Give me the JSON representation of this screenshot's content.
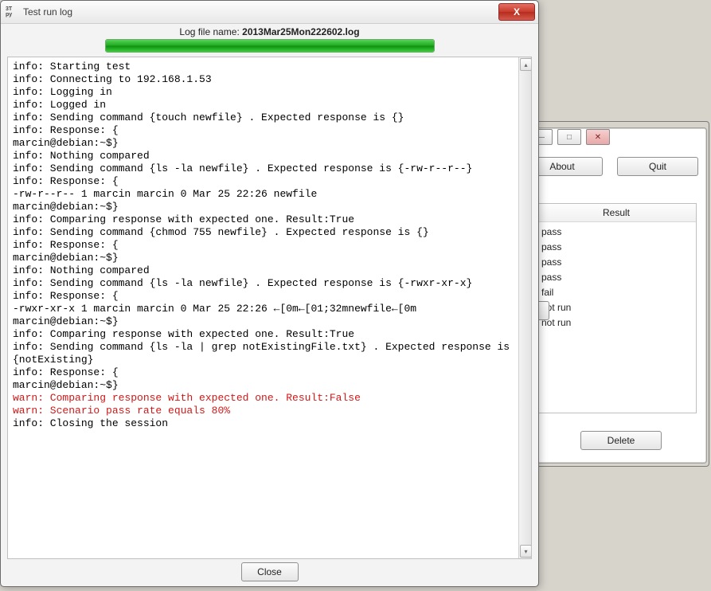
{
  "dialog": {
    "title": "Test run log",
    "app_icon_top": "3T",
    "app_icon_bottom": "py",
    "close_x": "X",
    "log_label": "Log file name: ",
    "log_filename": "2013Mar25Mon222602.log",
    "close_button": "Close",
    "scroll_up": "▴",
    "scroll_down": "▾"
  },
  "log": {
    "lines": [
      {
        "t": "info: Starting test"
      },
      {
        "t": "info: Connecting to 192.168.1.53"
      },
      {
        "t": "info: Logging in"
      },
      {
        "t": "info: Logged in"
      },
      {
        "t": "info: Sending command {touch newfile} . Expected response is {}"
      },
      {
        "t": "info: Response: {"
      },
      {
        "t": "marcin@debian:~$}"
      },
      {
        "t": "info: Nothing compared"
      },
      {
        "t": "info: Sending command {ls -la newfile} . Expected response is {-rw-r--r--}"
      },
      {
        "t": "info: Response: {"
      },
      {
        "t": "-rw-r--r-- 1 marcin marcin 0 Mar 25 22:26 newfile"
      },
      {
        "t": "marcin@debian:~$}"
      },
      {
        "t": "info: Comparing response with expected one. Result:True"
      },
      {
        "t": "info: Sending command {chmod 755 newfile} . Expected response is {}"
      },
      {
        "t": "info: Response: {"
      },
      {
        "t": "marcin@debian:~$}"
      },
      {
        "t": "info: Nothing compared"
      },
      {
        "t": "info: Sending command {ls -la newfile} . Expected response is {-rwxr-xr-x}"
      },
      {
        "t": "info: Response: {"
      },
      {
        "t": "-rwxr-xr-x 1 marcin marcin 0 Mar 25 22:26 ←[0m←[01;32mnewfile←[0m"
      },
      {
        "t": "marcin@debian:~$}"
      },
      {
        "t": "info: Comparing response with expected one. Result:True"
      },
      {
        "t": "info: Sending command {ls -la | grep notExistingFile.txt} . Expected response is {notExisting}"
      },
      {
        "t": "info: Response: {"
      },
      {
        "t": "marcin@debian:~$}"
      },
      {
        "t": "warn: Comparing response with expected one. Result:False",
        "cls": "warn"
      },
      {
        "t": "warn: Scenario pass rate equals 80%",
        "cls": "warn"
      },
      {
        "t": "info: Closing the session"
      }
    ]
  },
  "bgwin": {
    "min_glyph": "—",
    "max_glyph": "□",
    "close_glyph": "✕",
    "about": "About",
    "quit": "Quit",
    "delete": "Delete",
    "result_header": "Result",
    "results": [
      "pass",
      "pass",
      "pass",
      "pass",
      "fail",
      "not run",
      "not run"
    ]
  }
}
